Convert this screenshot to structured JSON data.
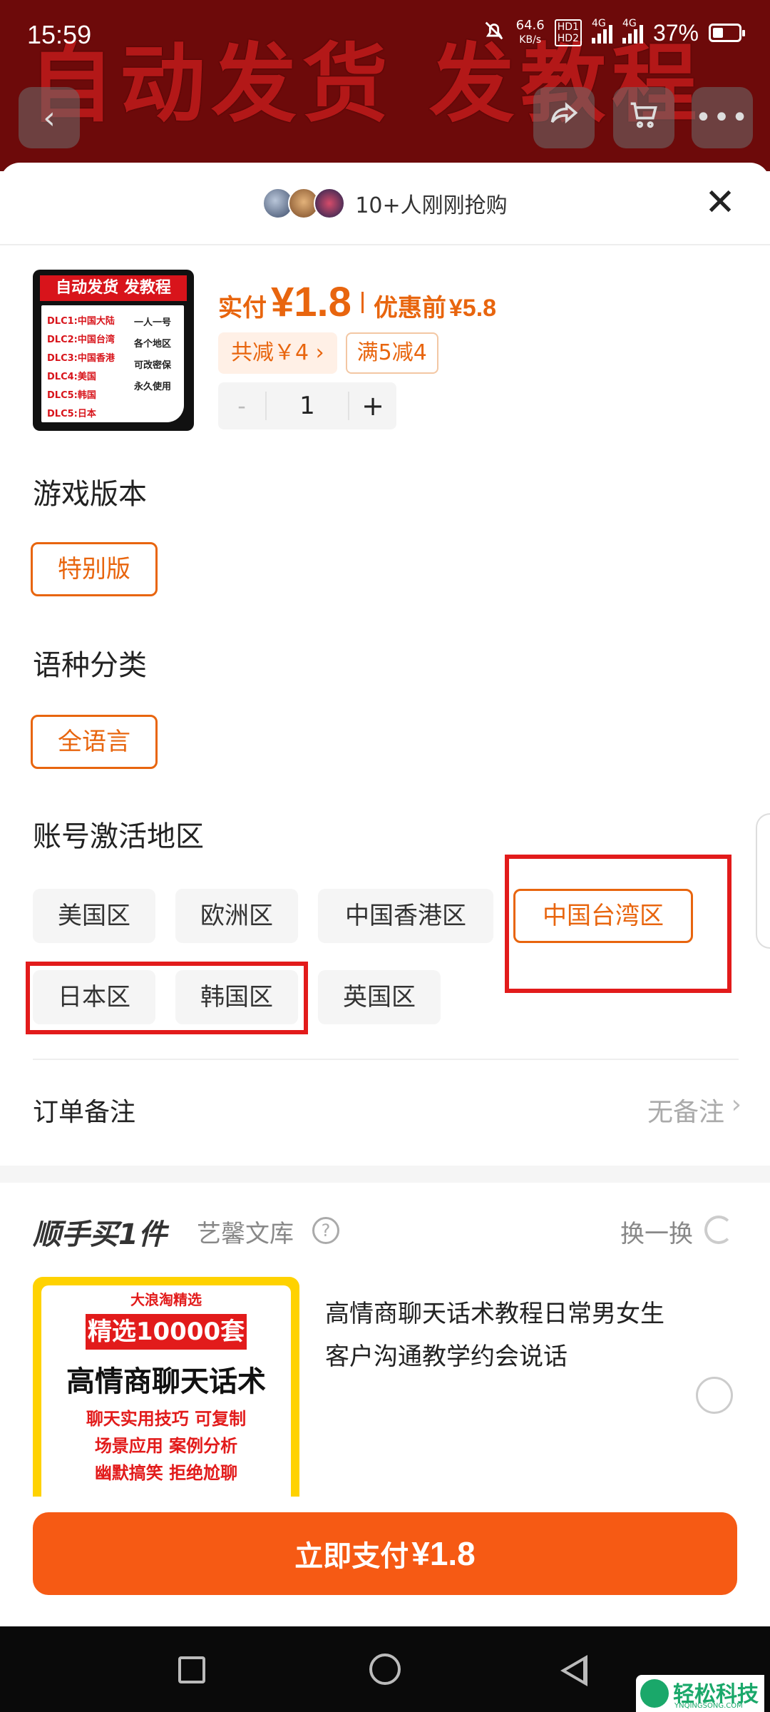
{
  "status_bar": {
    "time": "15:59",
    "net_speed_value": "64.6",
    "net_speed_unit": "KB/s",
    "hd1": "HD1",
    "hd2": "HD2",
    "sig1_tag": "4G",
    "sig2_tag": "4G",
    "battery": "37%"
  },
  "background": {
    "banner_text": "自动发货 发教程"
  },
  "sheet": {
    "buyers_text": "10+人刚刚抢购",
    "close_glyph": "✕"
  },
  "product": {
    "thumb_title": "自动发货 发教程",
    "thumb_dlc": [
      "DLC1:中国大陆",
      "DLC2:中国台湾",
      "DLC3:中国香港",
      "DLC4:美国",
      "DLC5:韩国",
      "DLC5:日本"
    ],
    "thumb_side": [
      "一人一号",
      "各个地区",
      "可改密保",
      "永久使用"
    ],
    "price_label": "实付",
    "price_value": "¥1.8",
    "orig_label": "优惠前",
    "orig_value": "¥5.8",
    "discount_total": "共减￥4 ›",
    "discount_rule": "满5减4",
    "quantity": "1",
    "minus": "-",
    "plus": "+"
  },
  "sections": {
    "version_title": "游戏版本",
    "version_options": [
      "特别版"
    ],
    "language_title": "语种分类",
    "language_options": [
      "全语言"
    ],
    "region_title": "账号激活地区",
    "region_options": [
      "美国区",
      "欧洲区",
      "中国香港区",
      "中国台湾区",
      "日本区",
      "韩国区",
      "英国区"
    ],
    "region_selected": "中国台湾区"
  },
  "remark": {
    "label": "订单备注",
    "value": "无备注",
    "arrow": "›"
  },
  "upsell": {
    "title": "顺手买1件",
    "shop": "艺馨文库",
    "help": "?",
    "swap": "换一换",
    "thumb_line1": "大浪淘精选",
    "thumb_line2": "精选10000套",
    "thumb_line3": "高情商聊天话术",
    "thumb_line4": "聊天实用技巧 可复制",
    "thumb_line5": "场景应用 案例分析",
    "thumb_line6": "幽默搞笑 拒绝尬聊",
    "name": "高情商聊天话术教程日常男女生客户沟通教学约会说话"
  },
  "pay": {
    "label": "立即支付",
    "amount": "¥1.8"
  },
  "watermark": {
    "text": "轻松科技",
    "sub": "YNQINGSONG.COM"
  },
  "colors": {
    "accent": "#e8650e",
    "pay_button": "#f65a14",
    "annotation_red": "#e21b1b"
  }
}
